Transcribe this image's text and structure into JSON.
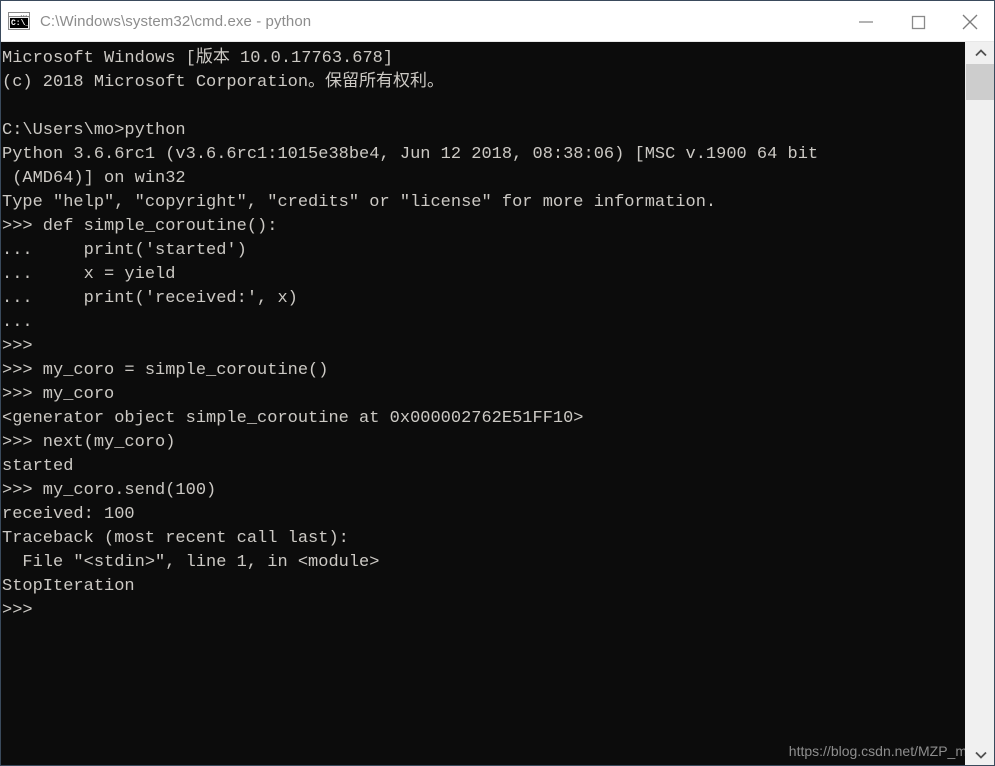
{
  "window": {
    "title": "C:\\Windows\\system32\\cmd.exe - python",
    "icon_name": "cmd-console-icon",
    "icon_glyph": "C:\\_",
    "background_color": "#0c0c0c",
    "text_color": "#ccc9c4",
    "titlebar_color": "#ffffff",
    "titlebar_text_color": "#8d8d8d"
  },
  "controls": {
    "minimize_label": "Minimize",
    "maximize_label": "Maximize",
    "close_label": "Close"
  },
  "console": {
    "lines": [
      "Microsoft Windows [版本 10.0.17763.678]",
      "(c) 2018 Microsoft Corporation。保留所有权利。",
      "",
      "C:\\Users\\mo>python",
      "Python 3.6.6rc1 (v3.6.6rc1:1015e38be4, Jun 12 2018, 08:38:06) [MSC v.1900 64 bit",
      " (AMD64)] on win32",
      "Type \"help\", \"copyright\", \"credits\" or \"license\" for more information.",
      ">>> def simple_coroutine():",
      "...     print('started')",
      "...     x = yield",
      "...     print('received:', x)",
      "...",
      ">>>",
      ">>> my_coro = simple_coroutine()",
      ">>> my_coro",
      "<generator object simple_coroutine at 0x000002762E51FF10>",
      ">>> next(my_coro)",
      "started",
      ">>> my_coro.send(100)",
      "received: 100",
      "Traceback (most recent call last):",
      "  File \"<stdin>\", line 1, in <module>",
      "StopIteration",
      ">>>"
    ]
  },
  "watermark": {
    "text": "https://blog.csdn.net/MZP_m"
  },
  "scrollbar": {
    "up_arrow": "▲",
    "down_arrow": "▼"
  }
}
